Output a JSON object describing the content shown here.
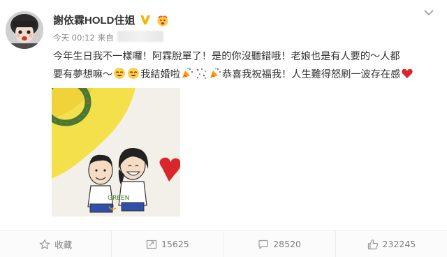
{
  "user": {
    "name": "謝依霖HOLD住姐"
  },
  "meta": {
    "time": "今天 00:12",
    "source_prefix": "来自"
  },
  "post": {
    "text_line1": "今年生日我不一樣囉！阿霖脫單了！是的你沒聽錯哦！老娘也是有人要的～人都",
    "text_line2a": "要有夢想嘛～",
    "text_line2b": "我結婚啦",
    "text_line2c": "恭喜我祝福我！人生難得怒刷一波存在感"
  },
  "image": {
    "caption_text": "GREEN"
  },
  "actions": [
    {
      "label": "收藏",
      "icon": "star-icon"
    },
    {
      "label": "15625",
      "icon": "repost-icon"
    },
    {
      "label": "28520",
      "icon": "comment-icon"
    },
    {
      "label": "232245",
      "icon": "like-icon"
    }
  ],
  "colors": {
    "heart": "#d9262b",
    "accent": "#f2a100"
  }
}
